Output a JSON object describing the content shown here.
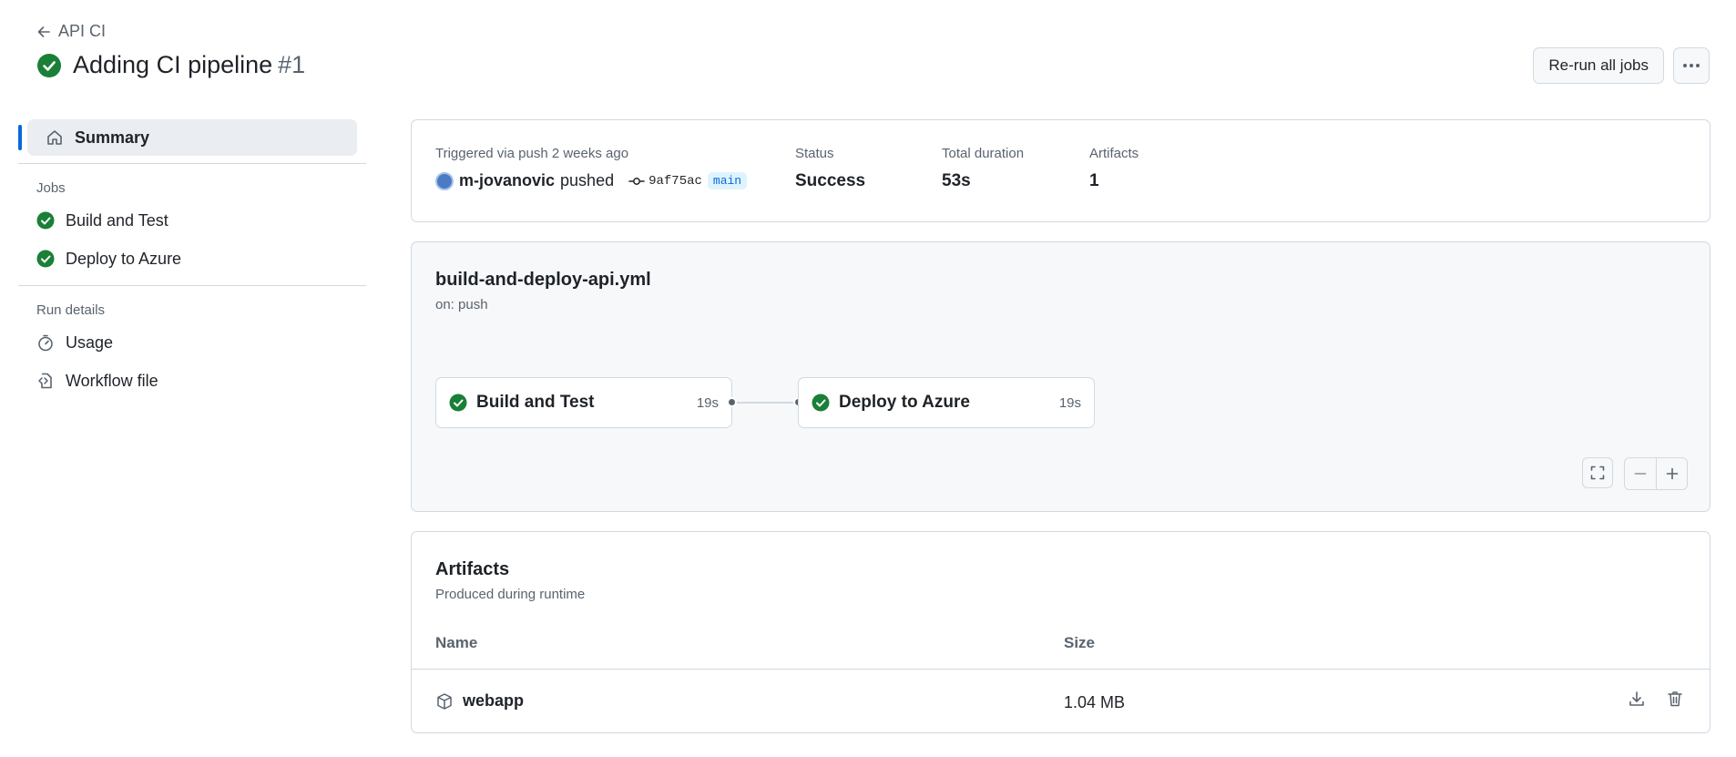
{
  "header": {
    "back_label": "API CI",
    "title": "Adding CI pipeline",
    "run_number": "#1",
    "rerun_label": "Re-run all jobs"
  },
  "sidebar": {
    "summary_label": "Summary",
    "jobs_heading": "Jobs",
    "jobs": [
      {
        "label": "Build and Test",
        "status": "success"
      },
      {
        "label": "Deploy to Azure",
        "status": "success"
      }
    ],
    "run_details_heading": "Run details",
    "usage_label": "Usage",
    "workflow_file_label": "Workflow file"
  },
  "summary": {
    "trigger_text": "Triggered via push 2 weeks ago",
    "actor": "m-jovanovic",
    "action": "pushed",
    "commit": "9af75ac",
    "branch": "main",
    "status_label": "Status",
    "status_value": "Success",
    "duration_label": "Total duration",
    "duration_value": "53s",
    "artifacts_label": "Artifacts",
    "artifacts_value": "1"
  },
  "graph": {
    "workflow_file": "build-and-deploy-api.yml",
    "trigger": "on: push",
    "jobs": [
      {
        "name": "Build and Test",
        "duration": "19s"
      },
      {
        "name": "Deploy to Azure",
        "duration": "19s"
      }
    ]
  },
  "artifacts": {
    "title": "Artifacts",
    "subtitle": "Produced during runtime",
    "col_name": "Name",
    "col_size": "Size",
    "rows": [
      {
        "name": "webapp",
        "size": "1.04 MB"
      }
    ]
  },
  "colors": {
    "success": "#1a7f37",
    "accent": "#0969da"
  }
}
